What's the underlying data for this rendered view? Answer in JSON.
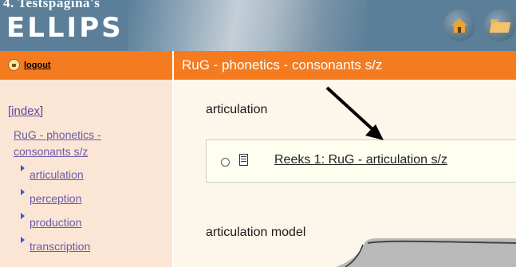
{
  "header": {
    "page_caption": "4. Testspagina's",
    "logo": "ELLIPS",
    "home_icon": "home-icon",
    "folder_icon": "folder-icon"
  },
  "sidebar": {
    "logout_label": "logout",
    "index_label": "[index]",
    "course_label": "RuG - phonetics - consonants s/z",
    "items": [
      {
        "label": "articulation"
      },
      {
        "label": "perception"
      },
      {
        "label": "production"
      },
      {
        "label": "transcription"
      }
    ]
  },
  "main": {
    "title": "RuG - phonetics - consonants s/z",
    "sections": [
      {
        "heading": "articulation",
        "resource": "Reeks 1: RuG - articulation s/z"
      },
      {
        "heading": "articulation model"
      }
    ]
  },
  "colors": {
    "header_bg": "#5c7f99",
    "accent_orange": "#f47b20",
    "sidebar_bg": "#fbe5d5",
    "content_bg": "#fdf6ea",
    "link_purple": "#6b5aa8"
  }
}
